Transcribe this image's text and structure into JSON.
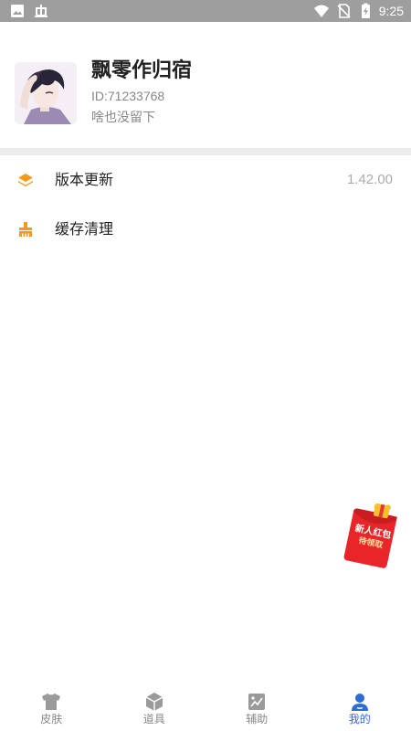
{
  "status_bar": {
    "time": "9:25"
  },
  "profile": {
    "name": "飘零作归宿",
    "id": "ID:71233768",
    "signature": "啥也没留下"
  },
  "menu": [
    {
      "label": "版本更新",
      "value": "1.42.00",
      "icon": "layers-icon"
    },
    {
      "label": "缓存清理",
      "value": "",
      "icon": "broom-icon"
    }
  ],
  "red_packet": {
    "line1": "新人红包",
    "line2": "待领取"
  },
  "bottom_nav": [
    {
      "label": "皮肤",
      "icon": "tshirt-icon",
      "active": false
    },
    {
      "label": "道具",
      "icon": "cube-icon",
      "active": false
    },
    {
      "label": "辅助",
      "icon": "image-icon",
      "active": false
    },
    {
      "label": "我的",
      "icon": "user-icon",
      "active": true
    }
  ],
  "colors": {
    "accent": "#2f6bd8",
    "menu_icon": "#f39a1e",
    "status_bar": "#9e9e9e",
    "inactive": "#9a9a9a"
  }
}
